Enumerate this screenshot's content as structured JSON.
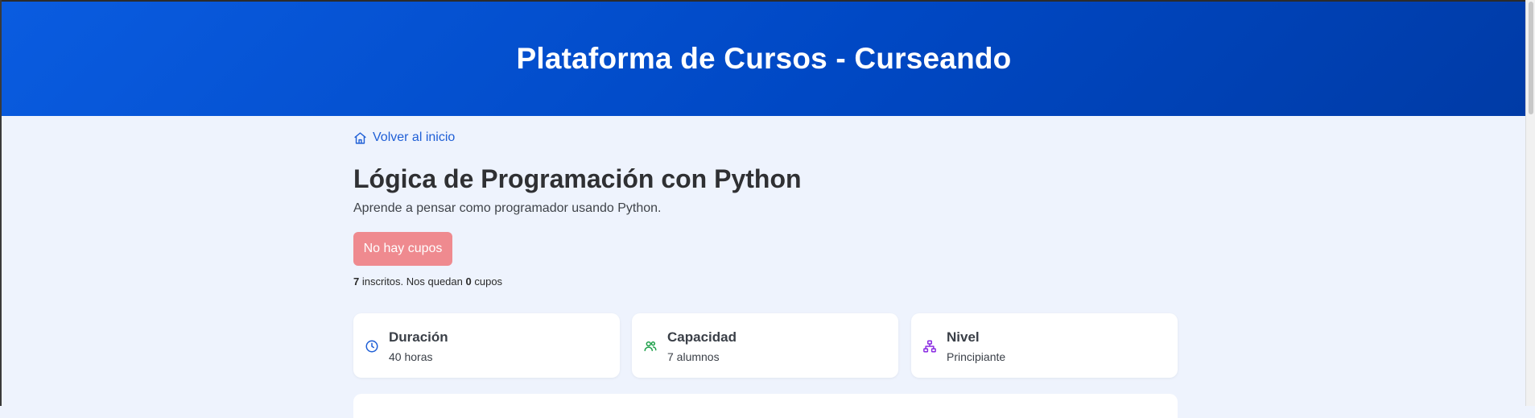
{
  "header": {
    "title": "Plataforma de Cursos - Curseando"
  },
  "nav": {
    "back_label": "Volver al inicio"
  },
  "course": {
    "title": "Lógica de Programación con Python",
    "description": "Aprende a pensar como programador usando Python.",
    "button_label": "No hay cupos",
    "enrolled_count": "7",
    "enrolled_text": "inscritos. Nos quedan",
    "remaining_count": "0",
    "remaining_text": "cupos"
  },
  "cards": [
    {
      "label": "Duración",
      "value": "40 horas",
      "icon": "clock-icon",
      "color": "#1f5fd6"
    },
    {
      "label": "Capacidad",
      "value": "7 alumnos",
      "icon": "users-icon",
      "color": "#1ea04a"
    },
    {
      "label": "Nivel",
      "value": "Principiante",
      "icon": "hierarchy-icon",
      "color": "#8a2be2"
    }
  ],
  "colors": {
    "header_blue": "#0052d4",
    "link_blue": "#1f5fd6",
    "button_disabled": "#ef8a8f",
    "page_bg": "#eef3fd"
  }
}
